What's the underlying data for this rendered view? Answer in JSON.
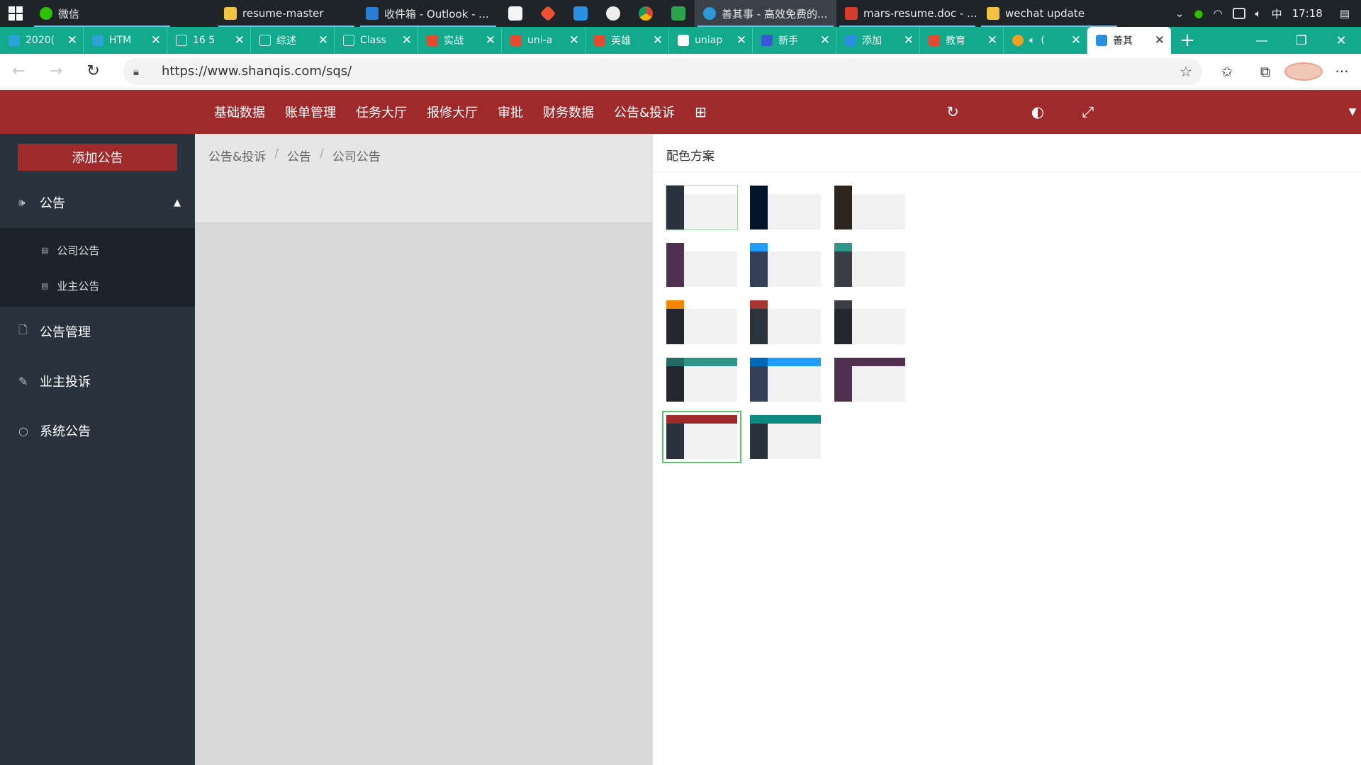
{
  "taskbar": {
    "apps": [
      {
        "label": "微信",
        "color": "#2dc100"
      },
      {
        "label": "resume-master",
        "color": "#f3c243"
      },
      {
        "label": "收件箱 - Outlook - ...",
        "color": "#2a7dd6"
      }
    ],
    "pinned": [
      {
        "icon": "typora-icon",
        "color": "#f5f5f5"
      },
      {
        "icon": "git-icon",
        "color": "#f05033"
      },
      {
        "icon": "vscode-icon",
        "color": "#2a8fe0"
      },
      {
        "icon": "wechat-devtools-icon",
        "color": "#eeeeee"
      },
      {
        "icon": "chrome-icon",
        "color": "#e3b33c"
      },
      {
        "icon": "hbuilder-icon",
        "color": "#2ba34c"
      }
    ],
    "apps2": [
      {
        "label": "善其事 - 高效免费的...",
        "color": "#2c9ad6"
      },
      {
        "label": "mars-resume.doc - ...",
        "color": "#d63a2a"
      },
      {
        "label": "wechat update",
        "color": "#f3c243"
      }
    ],
    "tray": {
      "ime": "中",
      "time": "17:18"
    }
  },
  "tabs": [
    {
      "label": "2020(",
      "color": "#2ba3d6"
    },
    {
      "label": "HTM",
      "color": "#2ba3d6"
    },
    {
      "label": "16 5",
      "color": "#e6f5f2"
    },
    {
      "label": "综述",
      "color": "#e6f5f2"
    },
    {
      "label": "Class",
      "color": "#e6f5f2"
    },
    {
      "label": "实战",
      "color": "#e34a30"
    },
    {
      "label": "uni-a",
      "color": "#e34a30"
    },
    {
      "label": "英雄",
      "color": "#e34a30"
    },
    {
      "label": "uniap",
      "color": "#ffffff"
    },
    {
      "label": "新手",
      "color": "#3b57d6"
    },
    {
      "label": "添加",
      "color": "#2a8fe0"
    },
    {
      "label": "教育",
      "color": "#e34a30"
    },
    {
      "label": "(",
      "color": "#f0a020"
    },
    {
      "label": "善其",
      "color": "#2a8fe0",
      "active": true
    }
  ],
  "address": {
    "url": "https://www.shanqis.com/sqs/"
  },
  "header": {
    "menu": [
      "基础数据",
      "账单管理",
      "任务大厅",
      "报修大厅",
      "审批",
      "财务数据",
      "公告&投诉"
    ],
    "menu_icon": "grid-icon",
    "right_icons": [
      "refresh-icon",
      "palette-icon",
      "fullscreen-icon",
      "caret-down-icon"
    ]
  },
  "sidebar": {
    "add_button": "添加公告",
    "group": {
      "label": "公告",
      "icon": "speaker-icon"
    },
    "sub_items": [
      "公司公告",
      "业主公告"
    ],
    "items": [
      {
        "label": "公告管理",
        "icon": "document-icon"
      },
      {
        "label": "业主投诉",
        "icon": "edit-icon"
      },
      {
        "label": "系统公告",
        "icon": "circle-icon"
      }
    ]
  },
  "breadcrumb": [
    "公告&投诉",
    "公告",
    "公司公告"
  ],
  "panel": {
    "title": "配色方案",
    "schemes": [
      {
        "logo": "#28333e",
        "side": "#28333e",
        "top": "#ffffff"
      },
      {
        "logo": "#03152a",
        "side": "#03152a",
        "top": "#ffffff"
      },
      {
        "logo": "#2e241b",
        "side": "#2e241b",
        "top": "#ffffff"
      },
      {
        "logo": "#50314f",
        "side": "#50314f",
        "top": "#ffffff"
      },
      {
        "logo": "#1e9fff",
        "side": "#344058",
        "top": "#ffffff"
      },
      {
        "logo": "#2f9688",
        "side": "#3b3d46",
        "top": "#ffffff"
      },
      {
        "logo": "#f78400",
        "side": "#23262e",
        "top": "#ffffff"
      },
      {
        "logo": "#a8342f",
        "side": "#2b333b",
        "top": "#ffffff"
      },
      {
        "logo": "#3b3d46",
        "side": "#23262e",
        "top": "#ffffff"
      },
      {
        "logo": "#226a62",
        "side": "#23262e",
        "top": "#2f9688"
      },
      {
        "logo": "#0069b7",
        "side": "#344058",
        "top": "#1e9fff"
      },
      {
        "logo": "#50314f",
        "side": "#50314f",
        "top": "#50314f"
      },
      {
        "logo": "#9e2a2b",
        "side": "#28333e",
        "top": "#9e2a2b",
        "selected": true
      },
      {
        "logo": "#0c8a80",
        "side": "#28333e",
        "top": "#0c8a80"
      }
    ]
  }
}
